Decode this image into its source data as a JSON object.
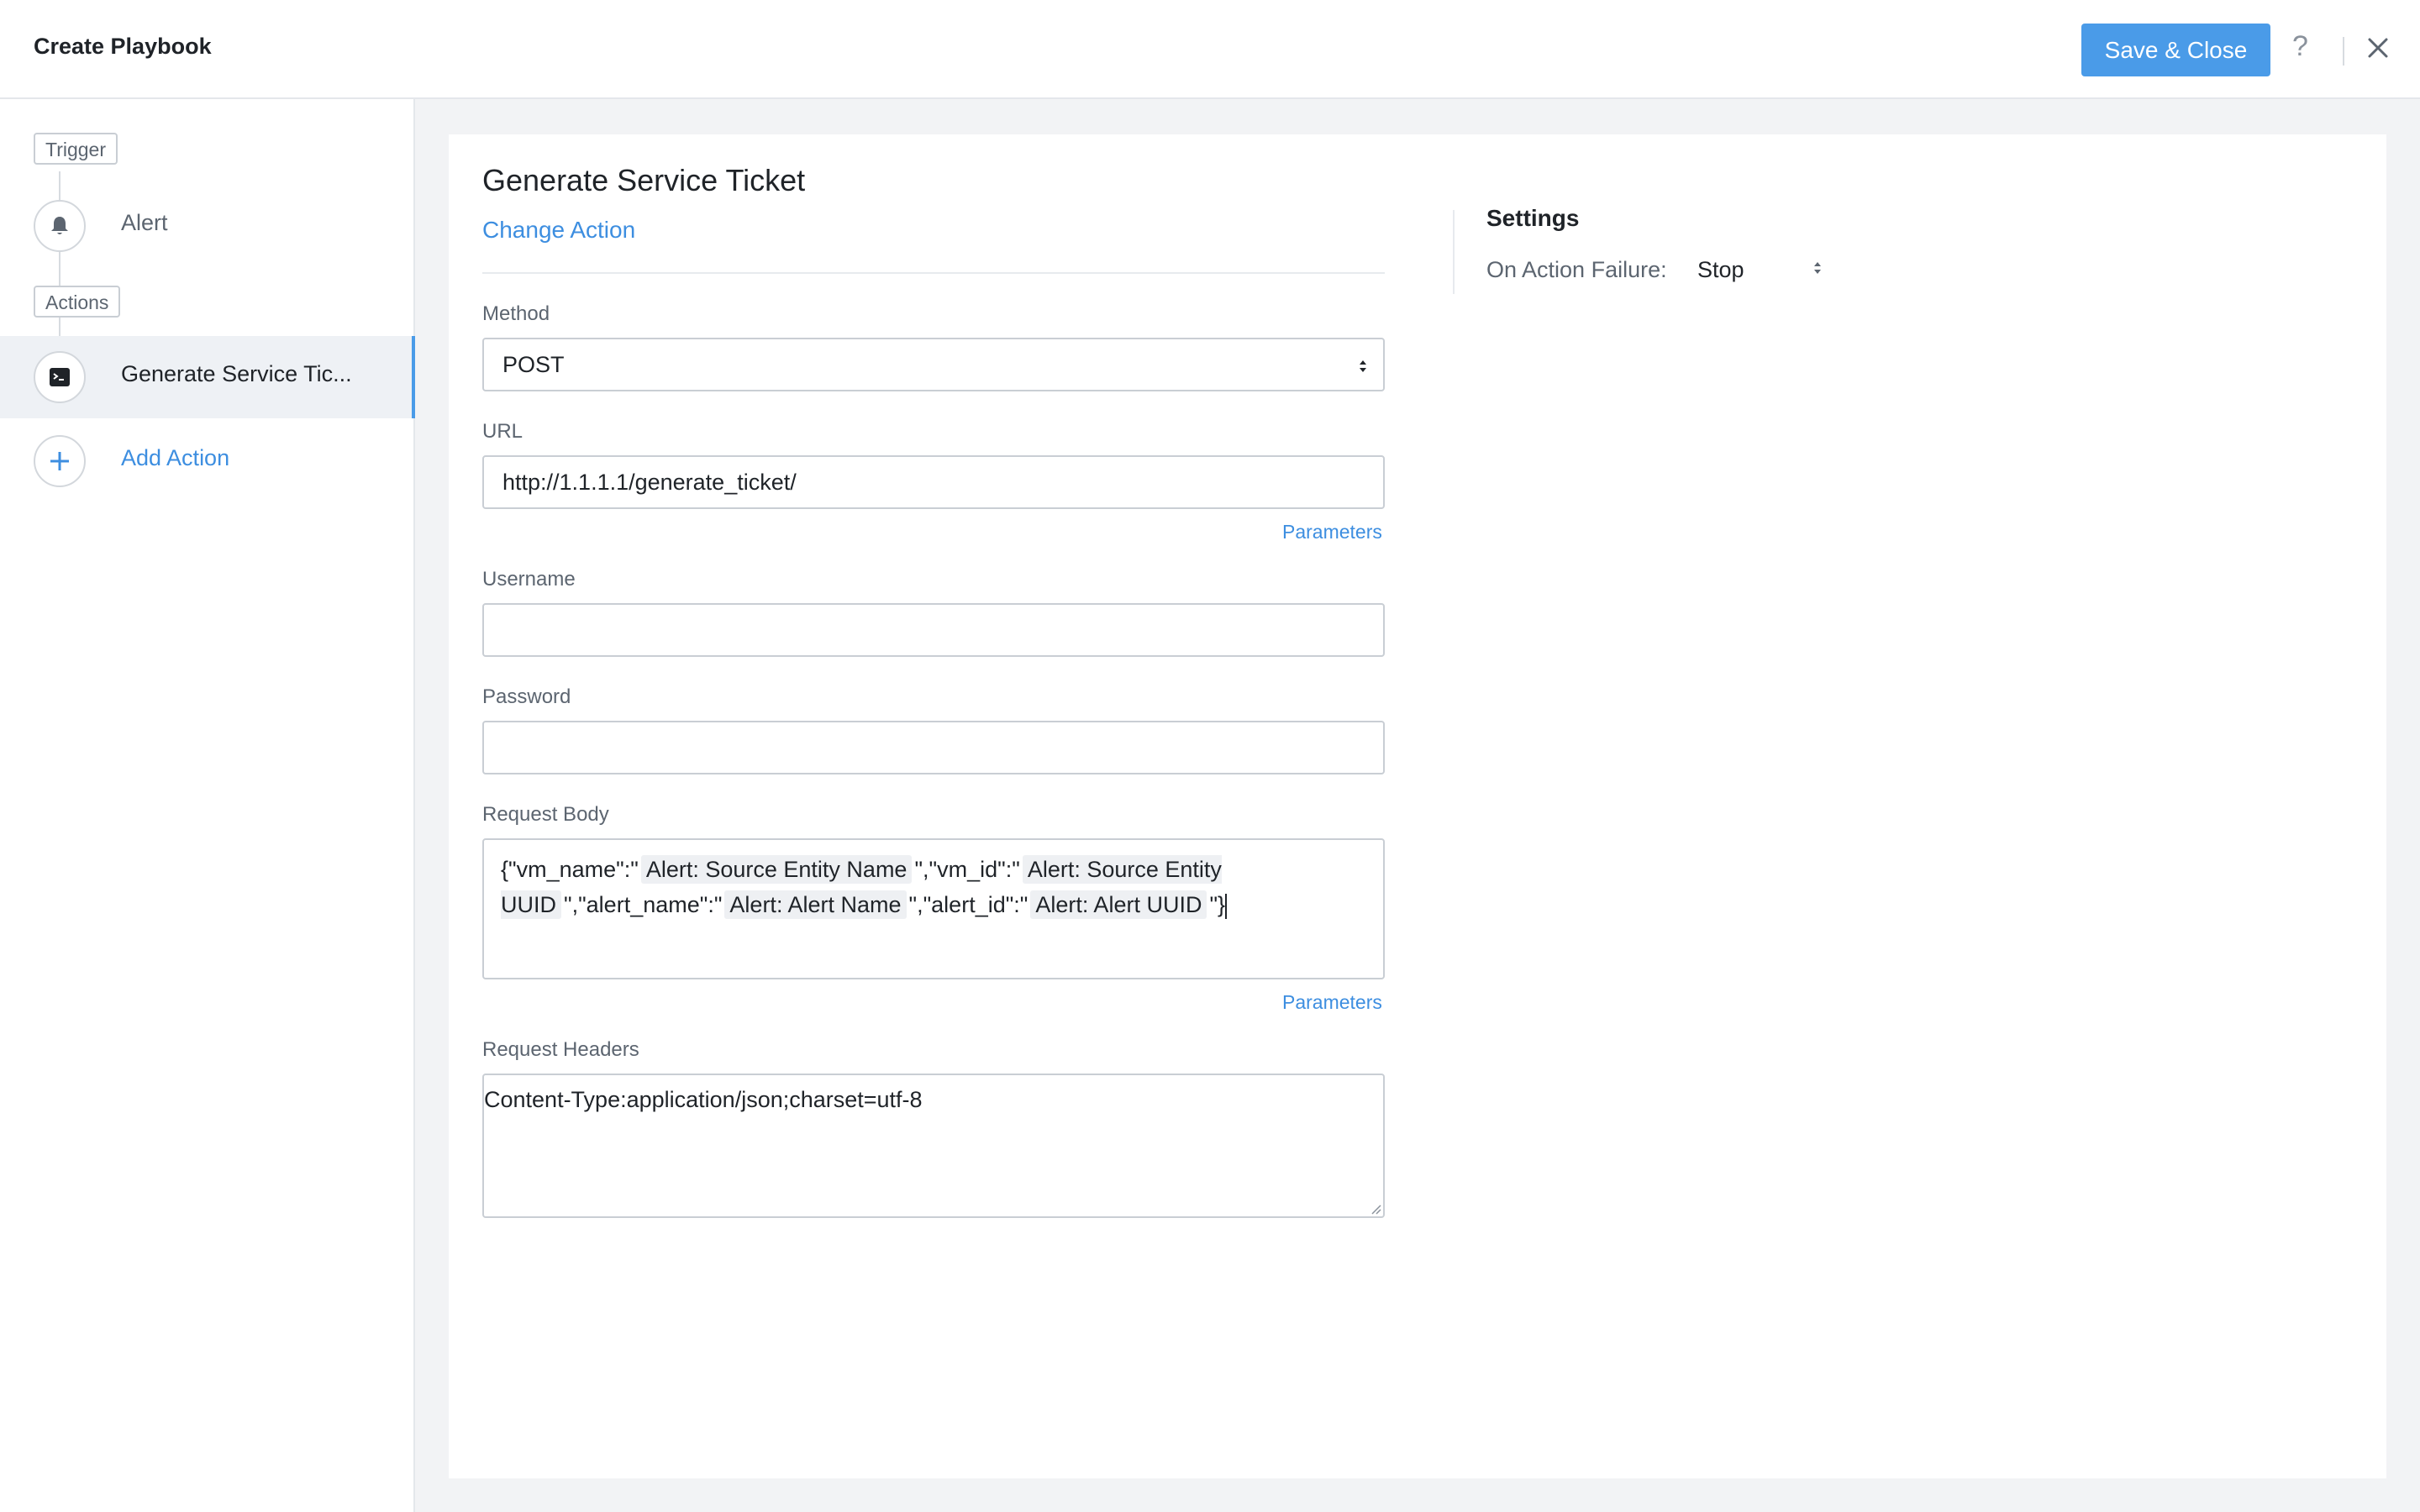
{
  "header": {
    "title": "Create Playbook",
    "save_label": "Save & Close",
    "help_icon": "?",
    "close_icon": "close-icon"
  },
  "sidebar": {
    "trigger_tag": "Trigger",
    "trigger_item": "Alert",
    "actions_tag": "Actions",
    "action_item": "Generate Service Tic...",
    "add_action": "Add Action"
  },
  "main": {
    "action_title": "Generate Service Ticket",
    "change_action": "Change Action",
    "method": {
      "label": "Method",
      "value": "POST"
    },
    "url": {
      "label": "URL",
      "value": "http://1.1.1.1/generate_ticket/",
      "parameters": "Parameters"
    },
    "username": {
      "label": "Username",
      "value": ""
    },
    "password": {
      "label": "Password",
      "value": ""
    },
    "request_body": {
      "label": "Request Body",
      "parameters": "Parameters",
      "segments": [
        "{\"vm_name\":\"",
        "Alert: Source Entity Name",
        "\",\"vm_id\":\"",
        "Alert: Source Entity UUID",
        "\",\"alert_name\":\"",
        "Alert: Alert Name",
        "\",\"alert_id\":\"",
        "Alert: Alert UUID",
        "\"}"
      ]
    },
    "request_headers": {
      "label": "Request Headers",
      "value": "Content-Type:application/json;charset=utf-8"
    }
  },
  "settings": {
    "title": "Settings",
    "on_failure_label": "On Action Failure:",
    "on_failure_value": "Stop"
  },
  "colors": {
    "accent": "#4a9be8",
    "link": "#3d8ee0"
  }
}
